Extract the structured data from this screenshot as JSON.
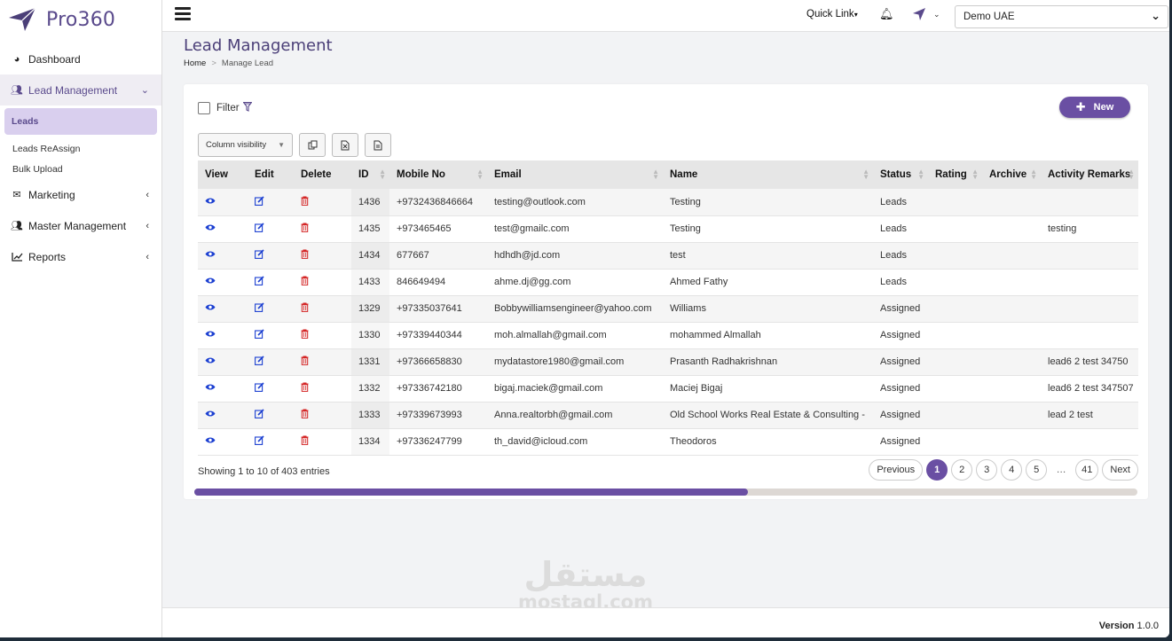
{
  "brand": {
    "name": "Pro360",
    "logo_icon": "paper-plane-arrow"
  },
  "sidebar": {
    "items": [
      {
        "label": "Dashboard",
        "icon": "gauge"
      },
      {
        "label": "Lead Management",
        "icon": "users"
      },
      {
        "label": "Marketing",
        "icon": "envelope"
      },
      {
        "label": "Master Management",
        "icon": "users"
      },
      {
        "label": "Reports",
        "icon": "chart-line"
      }
    ],
    "sub_items": [
      {
        "label": "Leads"
      },
      {
        "label": "Leads ReAssign"
      },
      {
        "label": "Bulk Upload"
      }
    ]
  },
  "topbar": {
    "quick_link": "Quick Link",
    "company": "Demo UAE"
  },
  "page": {
    "title": "Lead Management",
    "breadcrumb_home": "Home",
    "breadcrumb_sep": ">",
    "breadcrumb_current": "Manage Lead"
  },
  "controls": {
    "filter_label": "Filter",
    "new_button": "New",
    "column_visibility": "Column visibility"
  },
  "table": {
    "headers": [
      "View",
      "Edit",
      "Delete",
      "ID",
      "Mobile No",
      "Email",
      "Name",
      "Status",
      "Rating",
      "Archive",
      "Activity Remarks"
    ],
    "rows": [
      {
        "id": "1436",
        "mobile": "+9732436846664",
        "email": "testing@outlook.com",
        "name": "Testing",
        "status": "Leads",
        "rating": "",
        "archive": "",
        "remarks": ""
      },
      {
        "id": "1435",
        "mobile": "+973465465",
        "email": "test@gmailc.com",
        "name": "Testing",
        "status": "Leads",
        "rating": "",
        "archive": "",
        "remarks": "testing"
      },
      {
        "id": "1434",
        "mobile": "677667",
        "email": "hdhdh@jd.com",
        "name": "test",
        "status": "Leads",
        "rating": "",
        "archive": "",
        "remarks": ""
      },
      {
        "id": "1433",
        "mobile": "846649494",
        "email": "ahme.dj@gg.com",
        "name": "Ahmed Fathy",
        "status": "Leads",
        "rating": "",
        "archive": "",
        "remarks": ""
      },
      {
        "id": "1329",
        "mobile": "+97335037641",
        "email": "Bobbywilliamsengineer@yahoo.com",
        "name": "Williams",
        "status": "Assigned",
        "rating": "",
        "archive": "",
        "remarks": ""
      },
      {
        "id": "1330",
        "mobile": "+97339440344",
        "email": "moh.almallah@gmail.com",
        "name": "mohammed Almallah",
        "status": "Assigned",
        "rating": "",
        "archive": "",
        "remarks": ""
      },
      {
        "id": "1331",
        "mobile": "+97366658830",
        "email": "mydatastore1980@gmail.com",
        "name": "Prasanth Radhakrishnan",
        "status": "Assigned",
        "rating": "",
        "archive": "",
        "remarks": "lead6 2 test 34750"
      },
      {
        "id": "1332",
        "mobile": "+97336742180",
        "email": "bigaj.maciek@gmail.com",
        "name": "Maciej Bigaj",
        "status": "Assigned",
        "rating": "",
        "archive": "",
        "remarks": "lead6 2 test 347507"
      },
      {
        "id": "1333",
        "mobile": "+97339673993",
        "email": "Anna.realtorbh@gmail.com",
        "name": "Old School Works Real Estate & Consulting -",
        "status": "Assigned",
        "rating": "",
        "archive": "",
        "remarks": "lead 2 test"
      },
      {
        "id": "1334",
        "mobile": "+97336247799",
        "email": "th_david@icloud.com",
        "name": "Theodoros",
        "status": "Assigned",
        "rating": "",
        "archive": "",
        "remarks": ""
      }
    ]
  },
  "pagination": {
    "showing": "Showing 1 to 10 of 403 entries",
    "previous": "Previous",
    "pages": [
      "1",
      "2",
      "3",
      "4",
      "5"
    ],
    "ellipsis": "…",
    "last": "41",
    "next": "Next",
    "current": "1"
  },
  "scroll": {
    "position_fraction": 0.59
  },
  "watermark": {
    "arabic": "مستقل",
    "latin": "mostaql.com"
  },
  "footer": {
    "version_label": "Version",
    "version_number": "1.0.0"
  },
  "colors": {
    "accent": "#6a4fa3",
    "brand_text": "#5a4a8c",
    "delete": "#d42424",
    "link": "#1b3fd1"
  }
}
